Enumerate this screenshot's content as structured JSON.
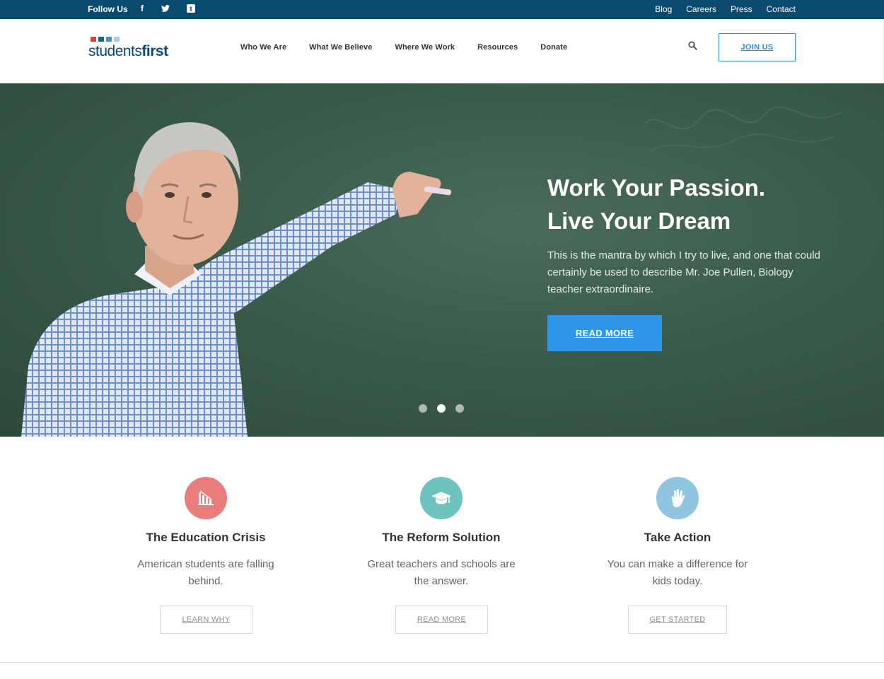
{
  "topbar": {
    "follow_label": "Follow Us",
    "social": [
      "facebook-icon",
      "twitter-icon",
      "tumblr-icon"
    ],
    "links": [
      "Blog",
      "Careers",
      "Press",
      "Contact"
    ]
  },
  "header": {
    "logo_part1": "students",
    "logo_part2": "first",
    "nav": [
      "Who We Are",
      "What We Believe",
      "Where We Work",
      "Resources",
      "Donate"
    ],
    "join_label": "JOIN US"
  },
  "hero": {
    "title_line1": "Work Your Passion.",
    "title_line2": "Live Your Dream",
    "text": "This is the mantra by which I try to live, and one that could certainly be used to describe Mr. Joe Pullen, Biology teacher extraordinaire.",
    "button_label": "READ MORE",
    "slides": 3,
    "active_slide": 2
  },
  "features": [
    {
      "icon": "chart-decline-icon",
      "color": "#e87d7b",
      "title": "The Education Crisis",
      "text": "American students are falling behind.",
      "button": "LEARN WHY"
    },
    {
      "icon": "graduation-cap-icon",
      "color": "#6fc3be",
      "title": "The Reform Solution",
      "text": "Great teachers and schools are the answer.",
      "button": "READ MORE"
    },
    {
      "icon": "raised-hand-icon",
      "color": "#8fc5e0",
      "title": "Take Action",
      "text": "You can make a difference for kids today.",
      "button": "GET STARTED"
    }
  ],
  "colors": {
    "topbar": "#0b4a6f",
    "accent": "#2e97ea",
    "logo_red": "#d6403e",
    "logo_blue": "#1f5e8e"
  }
}
